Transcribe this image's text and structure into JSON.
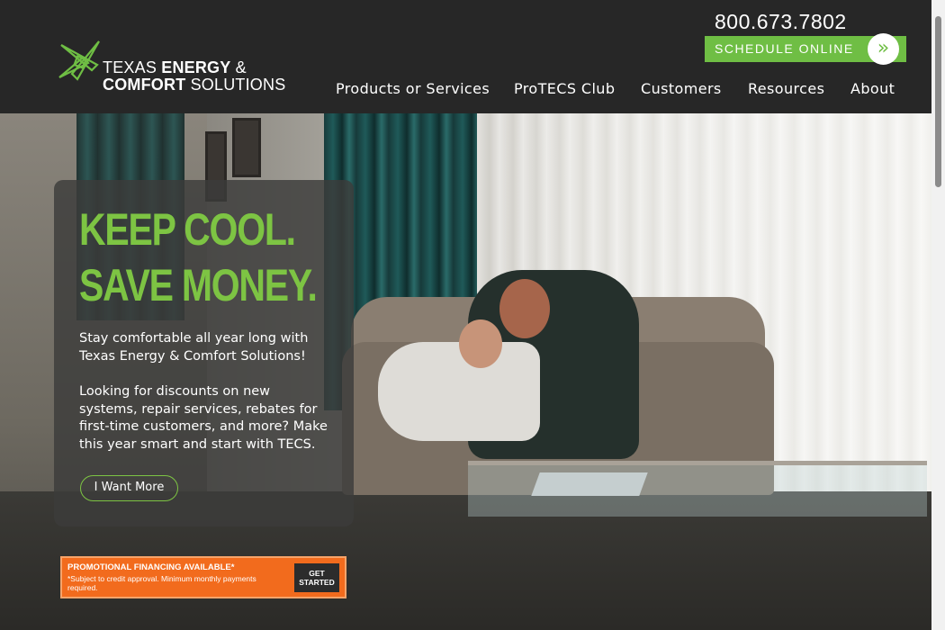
{
  "header": {
    "logo": {
      "line1_light": "TEXAS",
      "line1_bold": "ENERGY",
      "line1_amp": "&",
      "line2_bold": "COMFORT",
      "line2_light": "SOLUTIONS"
    },
    "phone": "800.673.7802",
    "schedule_label": "SCHEDULE ONLINE",
    "schedule_icon": "double-chevron-right-icon",
    "nav": [
      {
        "label": "Products or Services"
      },
      {
        "label": "ProTECS Club"
      },
      {
        "label": "Customers"
      },
      {
        "label": "Resources"
      },
      {
        "label": "About"
      }
    ]
  },
  "hero": {
    "headline_line1": "KEEP COOL.",
    "headline_line2": "SAVE MONEY.",
    "paragraph1": "Stay comfortable all year long with Texas Energy & Comfort Solutions!",
    "paragraph2": "Looking for discounts on new systems, repair services, rebates for first-time customers, and more? Make this year smart and start with TECS.",
    "cta_label": "I Want More"
  },
  "promo": {
    "title": "PROMOTIONAL FINANCING AVAILABLE*",
    "subtitle": "*Subject to credit approval. Minimum monthly payments required.",
    "button_line1": "GET",
    "button_line2": "STARTED"
  },
  "colors": {
    "header_bg": "#272727",
    "accent_green": "#6fbe44",
    "headline_green": "#7dc443",
    "promo_orange": "#f26b1d"
  }
}
